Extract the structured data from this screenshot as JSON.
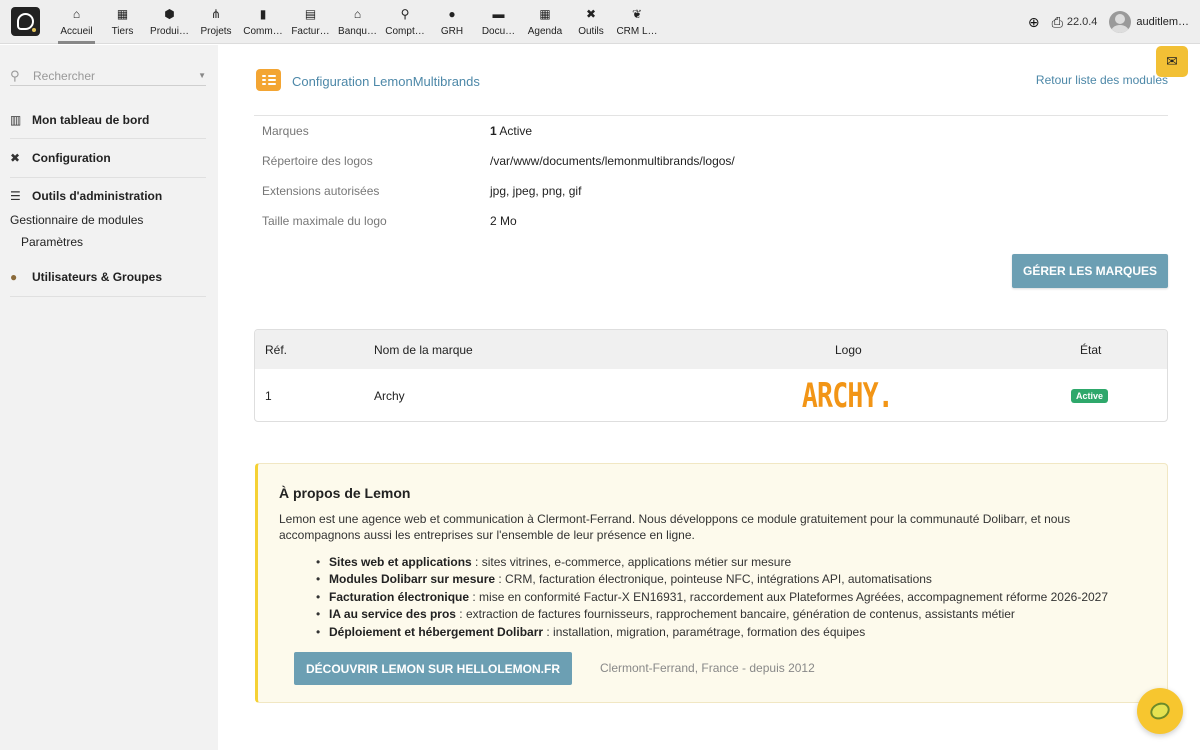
{
  "nav": [
    {
      "label": "Accueil",
      "icon": "home-icon",
      "glyph": "⌂"
    },
    {
      "label": "Tiers",
      "icon": "building-icon",
      "glyph": "▦"
    },
    {
      "label": "Produi…",
      "icon": "cube-icon",
      "glyph": "⬢"
    },
    {
      "label": "Projets",
      "icon": "project-icon",
      "glyph": "⋔"
    },
    {
      "label": "Comm…",
      "icon": "briefcase-icon",
      "glyph": "▮"
    },
    {
      "label": "Factur…",
      "icon": "invoice-icon",
      "glyph": "▤"
    },
    {
      "label": "Banqu…",
      "icon": "bank-icon",
      "glyph": "⌂"
    },
    {
      "label": "Compt…",
      "icon": "accounting-search-icon",
      "glyph": "⚲"
    },
    {
      "label": "GRH",
      "icon": "user-icon",
      "glyph": "●"
    },
    {
      "label": "Docu…",
      "icon": "folder-icon",
      "glyph": "▬"
    },
    {
      "label": "Agenda",
      "icon": "calendar-icon",
      "glyph": "▦"
    },
    {
      "label": "Outils",
      "icon": "tools-icon",
      "glyph": "✖"
    },
    {
      "label": "CRM L…",
      "icon": "leaf-icon",
      "glyph": "❦"
    }
  ],
  "topright": {
    "version": "22.0.4",
    "username": "auditlem…"
  },
  "sidebar": {
    "search_placeholder": "Rechercher",
    "dashboard": "Mon tableau de bord",
    "configuration": "Configuration",
    "admin_tools": "Outils d'administration",
    "module_manager": "Gestionnaire de modules",
    "parameters": "Paramètres",
    "users_groups": "Utilisateurs & Groupes"
  },
  "page": {
    "title": "Configuration LemonMultibrands",
    "back_link": "Retour liste des modules"
  },
  "props": [
    {
      "key": "Marques",
      "count": "1",
      "value": " Active"
    },
    {
      "key": "Répertoire des logos",
      "count": "",
      "value": "/var/www/documents/lemonmultibrands/logos/"
    },
    {
      "key": "Extensions autorisées",
      "count": "",
      "value": "jpg, jpeg, png, gif"
    },
    {
      "key": "Taille maximale du logo",
      "count": "",
      "value": "2 Mo"
    }
  ],
  "manage_button": "GÉRER LES MARQUES",
  "brands_table": {
    "headers": {
      "ref": "Réf.",
      "name": "Nom de la marque",
      "logo": "Logo",
      "state": "État"
    },
    "rows": [
      {
        "ref": "1",
        "name": "Archy",
        "logo_text": "ARCHY.",
        "state": "Active"
      }
    ]
  },
  "about": {
    "title": "À propos de Lemon",
    "text": "Lemon est une agence web et communication à Clermont-Ferrand. Nous développons ce module gratuitement pour la communauté Dolibarr, et nous accompagnons aussi les entreprises sur l'ensemble de leur présence en ligne.",
    "items": [
      {
        "b": "Sites web et applications",
        "t": " : sites vitrines, e-commerce, applications métier sur mesure"
      },
      {
        "b": "Modules Dolibarr sur mesure",
        "t": " : CRM, facturation électronique, pointeuse NFC, intégrations API, automatisations"
      },
      {
        "b": "Facturation électronique",
        "t": " : mise en conformité Factur-X EN16931, raccordement aux Plateformes Agréées, accompagnement réforme 2026-2027"
      },
      {
        "b": "IA au service des pros",
        "t": " : extraction de factures fournisseurs, rapprochement bancaire, génération de contenus, assistants métier"
      },
      {
        "b": "Déploiement et hébergement Dolibarr",
        "t": " : installation, migration, paramétrage, formation des équipes"
      }
    ],
    "button": "DÉCOUVRIR LEMON SUR HELLOLEMON.FR",
    "location": "Clermont-Ferrand, France - depuis 2012"
  },
  "colors": {
    "accent": "#6c9fb3",
    "link": "#4d88a8",
    "badge": "#2ea86b",
    "lemon": "#f5d134",
    "logo_orange": "#f29516"
  }
}
